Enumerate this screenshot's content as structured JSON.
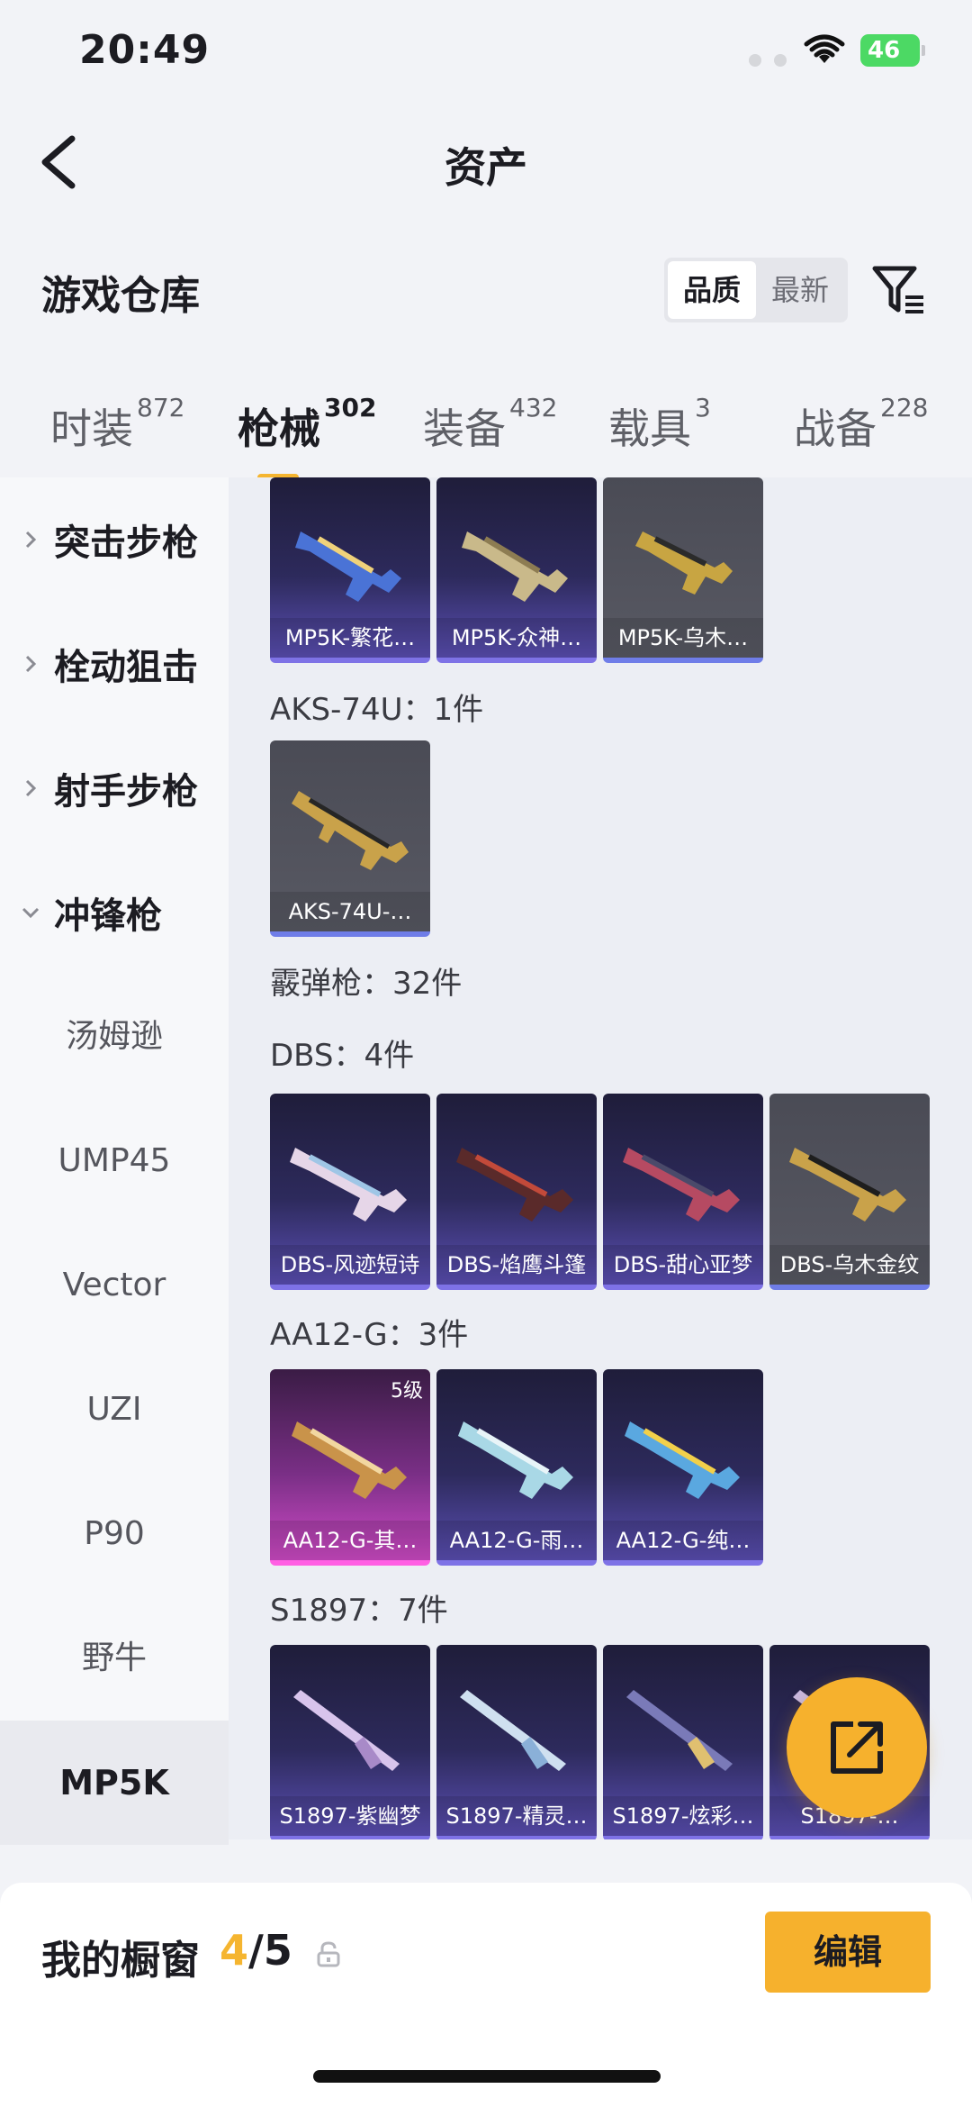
{
  "status_bar": {
    "time": "20:49",
    "battery": "46"
  },
  "nav": {
    "title": "资产"
  },
  "warehouse": {
    "title": "游戏仓库",
    "sort_options": [
      "品质",
      "最新"
    ],
    "active_sort": "品质"
  },
  "tabs": [
    {
      "label": "时装",
      "count": "872"
    },
    {
      "label": "枪械",
      "count": "302"
    },
    {
      "label": "装备",
      "count": "432"
    },
    {
      "label": "载具",
      "count": "3"
    },
    {
      "label": "战备",
      "count": "228"
    }
  ],
  "active_tab": "枪械",
  "sidebar": {
    "categories": [
      "突击步枪",
      "栓动狙击",
      "射手步枪",
      "冲锋枪"
    ],
    "subitems": [
      "汤姆逊",
      "UMP45",
      "Vector",
      "UZI",
      "P90",
      "野牛",
      "MP5K"
    ],
    "active_subitem": "MP5K"
  },
  "groups": {
    "aks": "AKS-74U：1件",
    "shotgun": "霰弹枪：32件",
    "dbs": "DBS：4件",
    "aa12": "AA12-G：3件",
    "s1897": "S1897：7件"
  },
  "cards": {
    "mp5k": [
      "MP5K-繁花…",
      "MP5K-众神…",
      "MP5K-乌木…"
    ],
    "aks": [
      "AKS-74U-…"
    ],
    "dbs": [
      "DBS-风迹短诗",
      "DBS-焰鹰斗篷",
      "DBS-甜心亚梦",
      "DBS-乌木金纹"
    ],
    "aa12": [
      "AA12-G-其…",
      "AA12-G-雨…",
      "AA12-G-纯…"
    ],
    "aa12_level": "5级",
    "s1897": [
      "S1897-紫幽梦",
      "S1897-精灵…",
      "S1897-炫彩…",
      "S1897-…"
    ]
  },
  "showcase": {
    "label": "我的橱窗",
    "current": "4",
    "total": "/5",
    "edit_label": "编辑"
  },
  "colors": {
    "accent": "#f5b530",
    "rare_purple": "#7e72e6",
    "legend_pink": "#ff5fe3"
  },
  "icons": [
    "back-arrow-icon",
    "filter-icon",
    "wifi-icon",
    "chevron-right-icon",
    "chevron-down-icon",
    "share-icon",
    "lock-icon"
  ]
}
